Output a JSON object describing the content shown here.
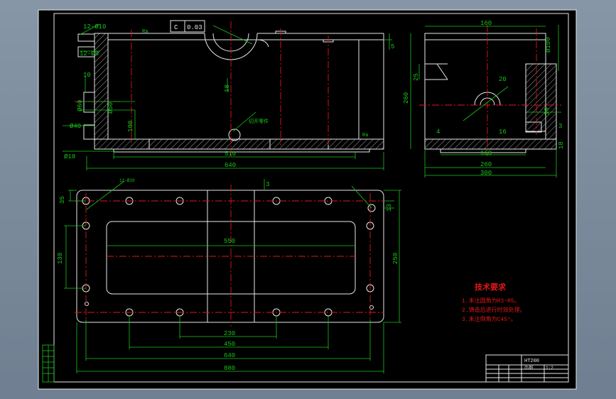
{
  "colors": {
    "background": "#7b8b9c",
    "sheet": "#000000",
    "outline": "#e8e8e8",
    "dimension": "#19c619",
    "centerline": "#e01818"
  },
  "front_view": {
    "dims": {
      "bolt_holes": "12-Ø10",
      "bolt_holes_2": "12-Ø8",
      "thread": "5",
      "ten": "10",
      "dia60": "Ø60",
      "dia50": "Ø50",
      "dia40": "Ø40",
      "dia18": "Ø18",
      "h100": "100",
      "t18": "18",
      "len510": "510",
      "len640": "640"
    },
    "tolerance": {
      "symbol": "C",
      "value": "0.03"
    },
    "note": "切开零件",
    "roughness": "Ra"
  },
  "side_view": {
    "dims": {
      "top160": "160",
      "bot160": "160",
      "dia100": "Ø100",
      "w260": "260",
      "w300": "300",
      "h260": "260",
      "h25": "25",
      "r20": "20",
      "ten": "10",
      "sixteen": "16",
      "eighteen": "18",
      "three": "3",
      "four": "4"
    }
  },
  "plan_view": {
    "dims": {
      "len550": "550",
      "h130": "130",
      "h250": "250",
      "w35": "35",
      "w13": "13",
      "w3": "3",
      "len230": "230",
      "len450": "450",
      "len640": "640",
      "len880": "880"
    },
    "note": "12-Ø10"
  },
  "tech_requirements": {
    "title": "技术要求",
    "items": [
      "1.未注圆角为R3~R5。",
      "2.铸造后进行时效处理。",
      "3.未注倒角为C45°。"
    ]
  },
  "title_block": {
    "material": "HT200",
    "scale": "1:2",
    "part_no": "比例"
  }
}
